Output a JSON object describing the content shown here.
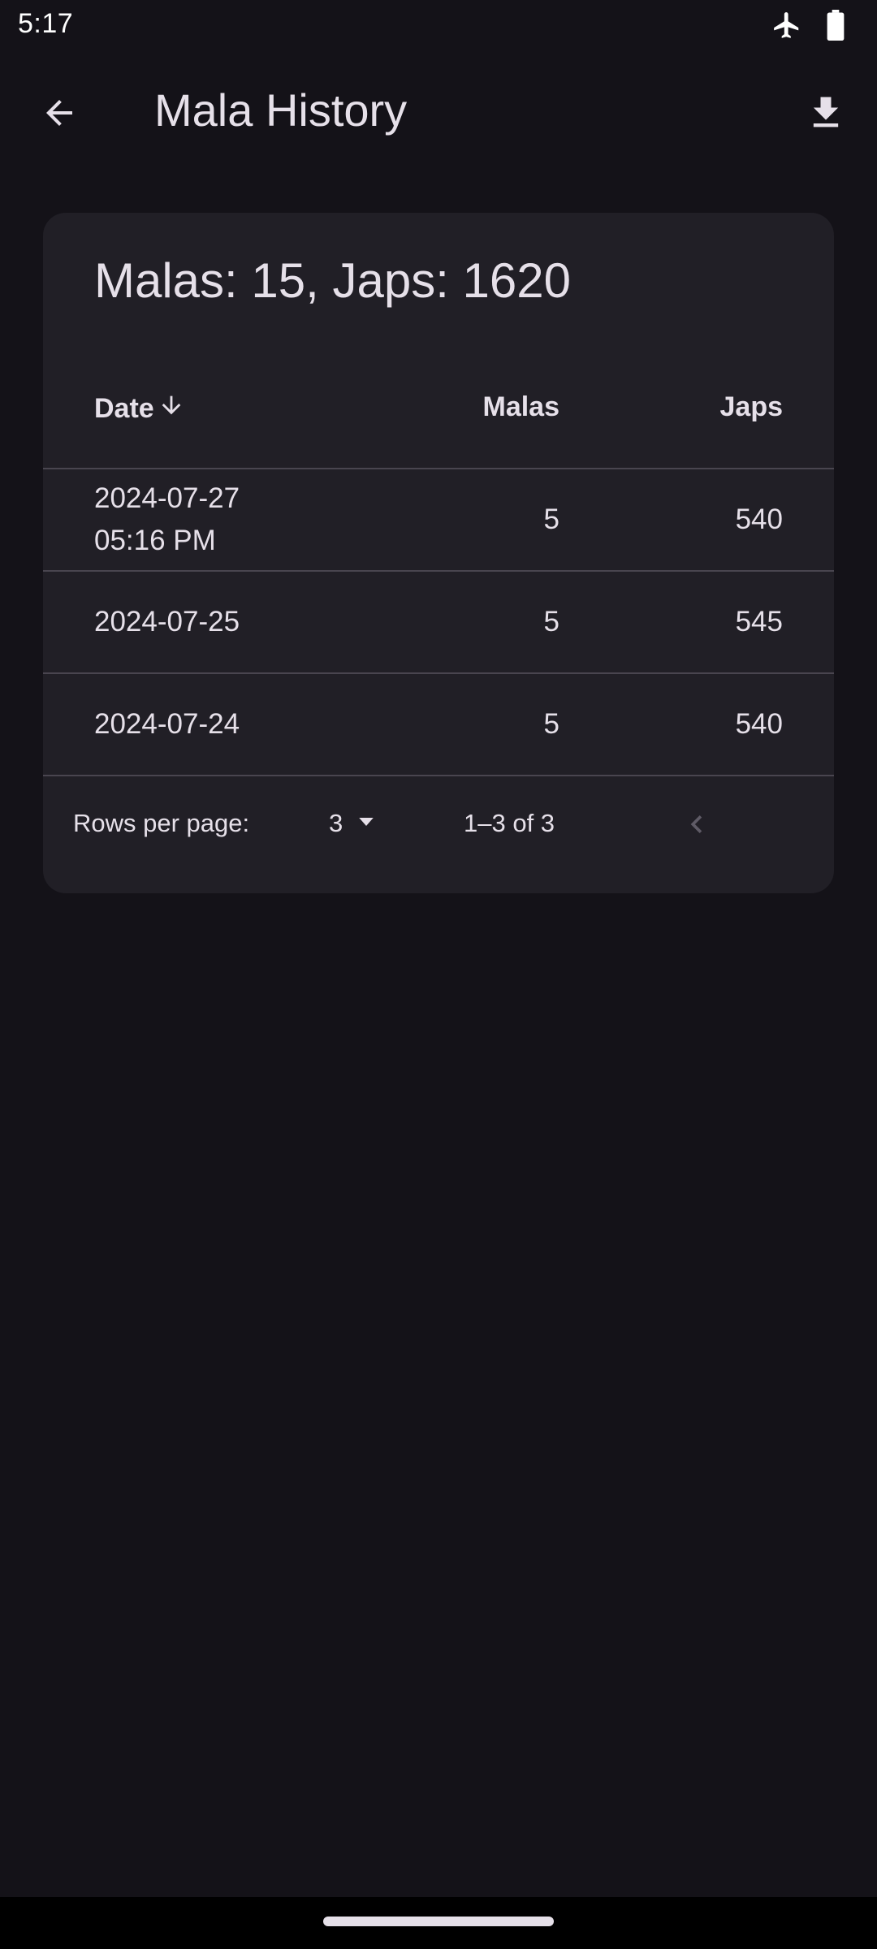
{
  "status_bar": {
    "time": "5:17",
    "icons": [
      "airplane-mode-icon",
      "battery-full-icon"
    ]
  },
  "app_bar": {
    "title": "Mala History",
    "back_icon": "arrow-back-icon",
    "download_icon": "download-icon"
  },
  "summary": {
    "text": "Malas: 15, Japs: 1620"
  },
  "table": {
    "columns": {
      "date": "Date",
      "malas": "Malas",
      "japs": "Japs"
    },
    "sort_icon": "arrow-down-icon",
    "rows": [
      {
        "date_line1": "2024-07-27",
        "date_line2": "05:16 PM",
        "malas": "5",
        "japs": "540"
      },
      {
        "date_line1": "2024-07-25",
        "date_line2": "",
        "malas": "5",
        "japs": "545"
      },
      {
        "date_line1": "2024-07-24",
        "date_line2": "",
        "malas": "5",
        "japs": "540"
      }
    ]
  },
  "pagination": {
    "rows_per_page_label": "Rows per page:",
    "rows_per_page_value": "3",
    "range": "1–3 of 3"
  },
  "colors": {
    "background": "#141218",
    "card": "#211f26",
    "text": "#e6e0e9",
    "divider": "#49454f",
    "disabled": "#5f5b66"
  }
}
